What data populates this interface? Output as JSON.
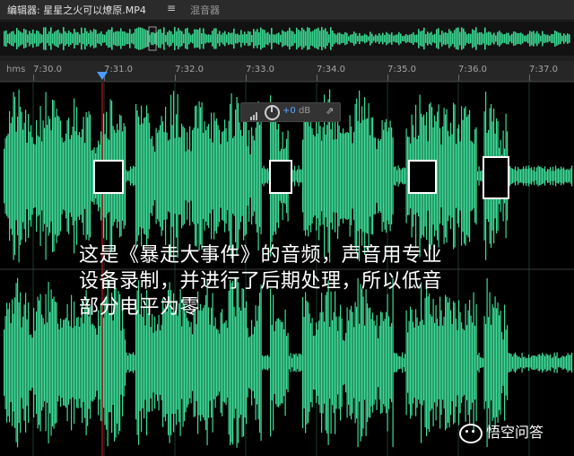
{
  "tabs": {
    "editor_label": "编辑器: 星星之火可以燎原.MP4",
    "menu_glyph": "≡",
    "mixer_label": "混音器"
  },
  "ruler": {
    "unit": "hms",
    "ticks": [
      "7:30.0",
      "7:31.0",
      "7:32.0",
      "7:33.0",
      "7:34.0",
      "7:35.0",
      "7:36.0",
      "7:37.0"
    ]
  },
  "hud": {
    "value": "+0",
    "unit": "dB",
    "icons": [
      "level-meter-icon",
      "volume-knob-icon",
      "pin-icon"
    ]
  },
  "caption": {
    "line1": "这是《暴走大事件》的音频，声音用专业",
    "line2": "设备录制，并进行了后期处理，所以低音",
    "line3": "部分电平为零"
  },
  "watermark": {
    "text": "悟空问答"
  },
  "colors": {
    "waveform": "#3ddc97",
    "overview_wave": "#39d690",
    "playhead": "#e02020",
    "playhead_handle": "#4d9bff",
    "background": "#000000",
    "caption": "#ffffff"
  }
}
